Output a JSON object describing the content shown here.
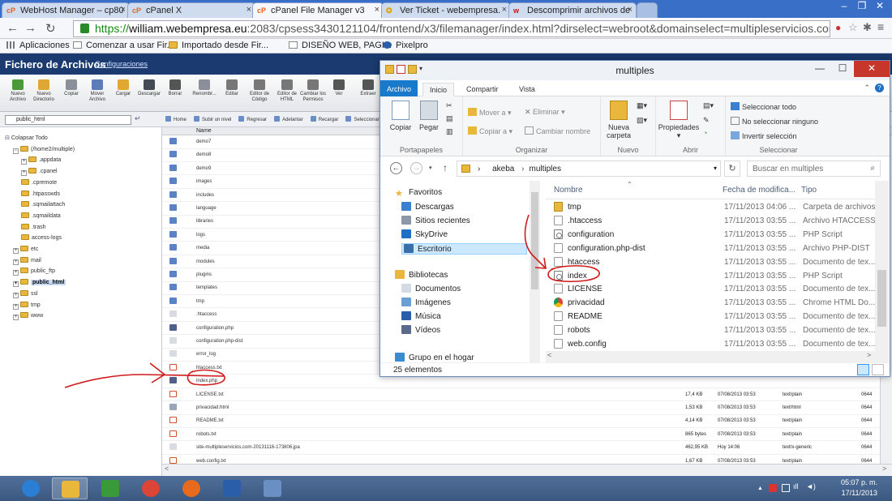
{
  "browser": {
    "tabs": [
      {
        "label": "WebHost Manager – cp80",
        "icon": "cpanel-icon"
      },
      {
        "label": "cPanel X",
        "icon": "cpanel-icon"
      },
      {
        "label": "cPanel File Manager v3",
        "icon": "cpanel-icon"
      },
      {
        "label": "Ver Ticket - webempresa.",
        "icon": "ticket-icon"
      },
      {
        "label": "Descomprimir archivos de",
        "icon": "webempresa-icon"
      }
    ],
    "active_tab": 2,
    "url_scheme": "https://",
    "url_domain": "william.webempresa.eu",
    "url_rest": ":2083/cpsess3430121104/frontend/x3/filemanager/index.html?dirselect=webroot&domainselect=multipleservicios.com",
    "bookmarks": [
      {
        "label": "Aplicaciones",
        "icon": "apps-icon"
      },
      {
        "label": "Comenzar a usar Fir...",
        "icon": "page-icon"
      },
      {
        "label": "Importado desde Fir...",
        "icon": "folder-icon"
      },
      {
        "label": "DISEÑO WEB, PAGI...",
        "icon": "page-icon"
      },
      {
        "label": "Pixelpro",
        "icon": "pixelpro-icon"
      }
    ]
  },
  "filemanager": {
    "title": "Fichero de Archivos",
    "config_link": "Configuraciones",
    "toolbar": [
      {
        "label": "Nuevo Archivo",
        "color": "#4a9a3a"
      },
      {
        "label": "Nuevo Directorio",
        "color": "#e0a832"
      },
      {
        "label": "Copiar",
        "color": "#8a8f99"
      },
      {
        "label": "Mover Archivo",
        "color": "#5a7cb8"
      },
      {
        "label": "Cargar",
        "color": "#e0a832"
      },
      {
        "label": "Descargar",
        "color": "#444a55"
      },
      {
        "label": "Borrar",
        "color": "#555"
      },
      {
        "label": "Renombr...",
        "color": "#8a8f99"
      },
      {
        "label": "Editar",
        "color": "#777"
      },
      {
        "label": "Editor de Código",
        "color": "#777"
      },
      {
        "label": "Editor de HTML",
        "color": "#777"
      },
      {
        "label": "Cambiar los Permisos",
        "color": "#777"
      },
      {
        "label": "Ver",
        "color": "#555"
      },
      {
        "label": "Extraer",
        "color": "#555"
      }
    ],
    "path_value": "public_html",
    "path_actions": [
      "Home",
      "Subir un nivel",
      "Regresar",
      "Adelantar",
      "Recargar",
      "Seleccionar"
    ],
    "tree": [
      {
        "label": "Colapsar Todo",
        "indent": 0,
        "kind": "action"
      },
      {
        "label": "(/home2/multiple)",
        "indent": 1,
        "kind": "root"
      },
      {
        "label": ".appdata",
        "indent": 2,
        "kind": "folder",
        "exp": true
      },
      {
        "label": ".cpanel",
        "indent": 2,
        "kind": "folder",
        "exp": true
      },
      {
        "label": ".cpremote",
        "indent": 2,
        "kind": "folder",
        "exp": false
      },
      {
        "label": ".htpasswds",
        "indent": 2,
        "kind": "folder",
        "exp": false
      },
      {
        "label": ".sqmailattach",
        "indent": 2,
        "kind": "folder",
        "exp": false
      },
      {
        "label": ".sqmaildata",
        "indent": 2,
        "kind": "folder",
        "exp": false
      },
      {
        "label": ".trash",
        "indent": 2,
        "kind": "folder",
        "exp": false
      },
      {
        "label": "access-logs",
        "indent": 2,
        "kind": "folder",
        "exp": false
      },
      {
        "label": "etc",
        "indent": 1,
        "kind": "folder",
        "exp": true
      },
      {
        "label": "mail",
        "indent": 1,
        "kind": "folder",
        "exp": true
      },
      {
        "label": "public_ftp",
        "indent": 1,
        "kind": "folder",
        "exp": true
      },
      {
        "label": "public_html",
        "indent": 1,
        "kind": "folder",
        "exp": true,
        "selected": true
      },
      {
        "label": "ssl",
        "indent": 1,
        "kind": "folder",
        "exp": true
      },
      {
        "label": "tmp",
        "indent": 1,
        "kind": "folder",
        "exp": true
      },
      {
        "label": "www",
        "indent": 1,
        "kind": "folder",
        "exp": true
      }
    ],
    "list_header_name": "Name",
    "files": [
      {
        "name": "demo7",
        "kind": "folder"
      },
      {
        "name": "demo8",
        "kind": "folder"
      },
      {
        "name": "demo9",
        "kind": "folder"
      },
      {
        "name": "images",
        "kind": "folder"
      },
      {
        "name": "includes",
        "kind": "folder"
      },
      {
        "name": "language",
        "kind": "folder"
      },
      {
        "name": "libraries",
        "kind": "folder"
      },
      {
        "name": "logs",
        "kind": "folder"
      },
      {
        "name": "media",
        "kind": "folder"
      },
      {
        "name": "modules",
        "kind": "folder"
      },
      {
        "name": "plugins",
        "kind": "folder"
      },
      {
        "name": "templates",
        "kind": "folder"
      },
      {
        "name": "tmp",
        "kind": "folder"
      },
      {
        "name": ".htaccess",
        "kind": "file"
      },
      {
        "name": "configuration.php",
        "kind": "php"
      },
      {
        "name": "configuration.php-dist",
        "kind": "file"
      },
      {
        "name": "error_log",
        "kind": "file"
      },
      {
        "name": "htaccess.txt",
        "kind": "text"
      },
      {
        "name": "index.php",
        "kind": "php"
      },
      {
        "name": "LICENSE.txt",
        "kind": "text",
        "size": "17,4 KB",
        "date": "07/08/2013 03:53",
        "type": "text/plain",
        "perm": "0644"
      },
      {
        "name": "privacidad.html",
        "kind": "html",
        "size": "1,53 KB",
        "date": "07/08/2013 03:53",
        "type": "text/html",
        "perm": "0644"
      },
      {
        "name": "README.txt",
        "kind": "text",
        "size": "4,14 KB",
        "date": "07/08/2013 03:53",
        "type": "text/plain",
        "perm": "0644"
      },
      {
        "name": "robots.txt",
        "kind": "text",
        "size": "865 bytes",
        "date": "07/08/2013 03:53",
        "type": "text/plain",
        "perm": "0644"
      },
      {
        "name": "site-multipleservicios.com-20131116-173806.jpa",
        "kind": "file",
        "size": "462,95 KB",
        "date": "Hoy 14:06",
        "type": "text/x-generic",
        "perm": "0644"
      },
      {
        "name": "web.config.txt",
        "kind": "text",
        "size": "1,67 KB",
        "date": "07/08/2013 03:53",
        "type": "text/plain",
        "perm": "0644"
      }
    ]
  },
  "explorer": {
    "title": "multiples",
    "tabs": [
      "Archivo",
      "Inicio",
      "Compartir",
      "Vista"
    ],
    "ribbon": {
      "portapapeles": {
        "name": "Portapapeles",
        "copy": "Copiar",
        "paste": "Pegar"
      },
      "organizar": {
        "name": "Organizar",
        "move": "Mover a",
        "copy_to": "Copiar a",
        "delete": "Eliminar",
        "rename": "Cambiar nombre"
      },
      "nuevo": {
        "name": "Nuevo",
        "new_folder": "Nueva carpeta"
      },
      "abrir": {
        "name": "Abrir",
        "properties": "Propiedades"
      },
      "seleccionar": {
        "name": "Seleccionar",
        "all": "Seleccionar todo",
        "none": "No seleccionar ninguno",
        "invert": "Invertir selección"
      }
    },
    "breadcrumb": [
      "akeba",
      "multiples"
    ],
    "search_placeholder": "Buscar en multiples",
    "nav": [
      {
        "label": "Favoritos",
        "indent": 0,
        "icon": "star"
      },
      {
        "label": "Descargas",
        "indent": 1,
        "icon": "downloads"
      },
      {
        "label": "Sitios recientes",
        "indent": 1,
        "icon": "recent"
      },
      {
        "label": "SkyDrive",
        "indent": 1,
        "icon": "skydrive"
      },
      {
        "label": "Escritorio",
        "indent": 1,
        "icon": "desktop",
        "selected": true
      },
      {
        "label": "",
        "indent": 0,
        "icon": "none"
      },
      {
        "label": "Bibliotecas",
        "indent": 0,
        "icon": "libraries"
      },
      {
        "label": "Documentos",
        "indent": 1,
        "icon": "documents"
      },
      {
        "label": "Imágenes",
        "indent": 1,
        "icon": "images"
      },
      {
        "label": "Música",
        "indent": 1,
        "icon": "music"
      },
      {
        "label": "Vídeos",
        "indent": 1,
        "icon": "videos"
      },
      {
        "label": "",
        "indent": 0,
        "icon": "none"
      },
      {
        "label": "Grupo en el hogar",
        "indent": 0,
        "icon": "homegroup"
      }
    ],
    "columns": {
      "name": "Nombre",
      "date": "Fecha de modifica...",
      "type": "Tipo"
    },
    "items": [
      {
        "name": "tmp",
        "date": "17/11/2013 04:06 ...",
        "type": "Carpeta de archivos",
        "icon": "folder"
      },
      {
        "name": ".htaccess",
        "date": "17/11/2013 03:55 ...",
        "type": "Archivo HTACCESS",
        "icon": "doc"
      },
      {
        "name": "configuration",
        "date": "17/11/2013 03:55 ...",
        "type": "PHP Script",
        "icon": "php"
      },
      {
        "name": "configuration.php-dist",
        "date": "17/11/2013 03:55 ...",
        "type": "Archivo PHP-DIST",
        "icon": "doc"
      },
      {
        "name": "htaccess",
        "date": "17/11/2013 03:55 ...",
        "type": "Documento de tex...",
        "icon": "doc"
      },
      {
        "name": "index",
        "date": "17/11/2013 03:55 ...",
        "type": "PHP Script",
        "icon": "php"
      },
      {
        "name": "LICENSE",
        "date": "17/11/2013 03:55 ...",
        "type": "Documento de tex...",
        "icon": "doc"
      },
      {
        "name": "privacidad",
        "date": "17/11/2013 03:55 ...",
        "type": "Chrome HTML Do...",
        "icon": "chrome"
      },
      {
        "name": "README",
        "date": "17/11/2013 03:55 ...",
        "type": "Documento de tex...",
        "icon": "doc"
      },
      {
        "name": "robots",
        "date": "17/11/2013 03:55 ...",
        "type": "Documento de tex...",
        "icon": "doc"
      },
      {
        "name": "web.config",
        "date": "17/11/2013 03:55 ...",
        "type": "Documento de tex...",
        "icon": "doc"
      }
    ],
    "status_count": "25 elementos"
  },
  "taskbar": {
    "apps": [
      {
        "name": "internet-explorer-icon",
        "color": "#2a7fd4"
      },
      {
        "name": "file-explorer-icon",
        "color": "#e8b73b",
        "active": true
      },
      {
        "name": "webempresa-app-icon",
        "color": "#3a9a3a"
      },
      {
        "name": "chrome-icon",
        "color": "#db4437"
      },
      {
        "name": "firefox-icon",
        "color": "#e86a1c"
      },
      {
        "name": "network-app-icon",
        "color": "#2a5ea8"
      },
      {
        "name": "calculator-icon",
        "color": "#6a8fc4"
      }
    ],
    "time": "05:07 p. m.",
    "date": "17/11/2013"
  },
  "colors": {
    "cpanel_header": "#1b3a6f",
    "win8_accent": "#1979ca",
    "annotation_red": "#d11a1a"
  }
}
